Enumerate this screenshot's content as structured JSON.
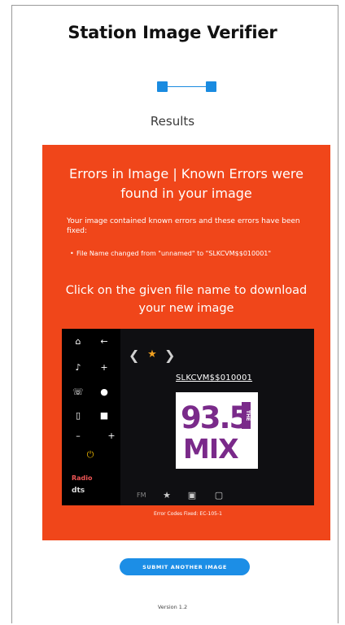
{
  "page": {
    "title": "Station Image Verifier",
    "step_label": "Results",
    "version": "Version 1.2"
  },
  "result": {
    "heading": "Errors in Image | Known Errors were found in your image",
    "description": "Your image contained known errors and these errors have been fixed:",
    "fixes": [
      "File Name changed from \"unnamed\" to \"SLKCVM$$010001\""
    ],
    "download_prompt": "Click on the given file name to download your new image",
    "panel_color": "#f0461a"
  },
  "preview": {
    "file_name": "SLKCVM$$010001",
    "logo_number": "93.5",
    "logo_the": "THE",
    "logo_word": "MIX",
    "radio_label": "Radio",
    "dts_label": "dts",
    "band_label": "FM",
    "error_code": "Error Codes Fixed: EC-105-1",
    "icons": [
      "home-icon",
      "back-icon",
      "music-icon",
      "person-add-icon",
      "phone-icon",
      "location-icon",
      "phone-screen-icon",
      "car-icon",
      "minus-icon",
      "plus-icon",
      "power-icon",
      "star-icon",
      "favorites-icon",
      "settings-icon"
    ]
  },
  "actions": {
    "submit_label": "SUBMIT ANOTHER IMAGE",
    "accent_color": "#1c8ee6"
  }
}
